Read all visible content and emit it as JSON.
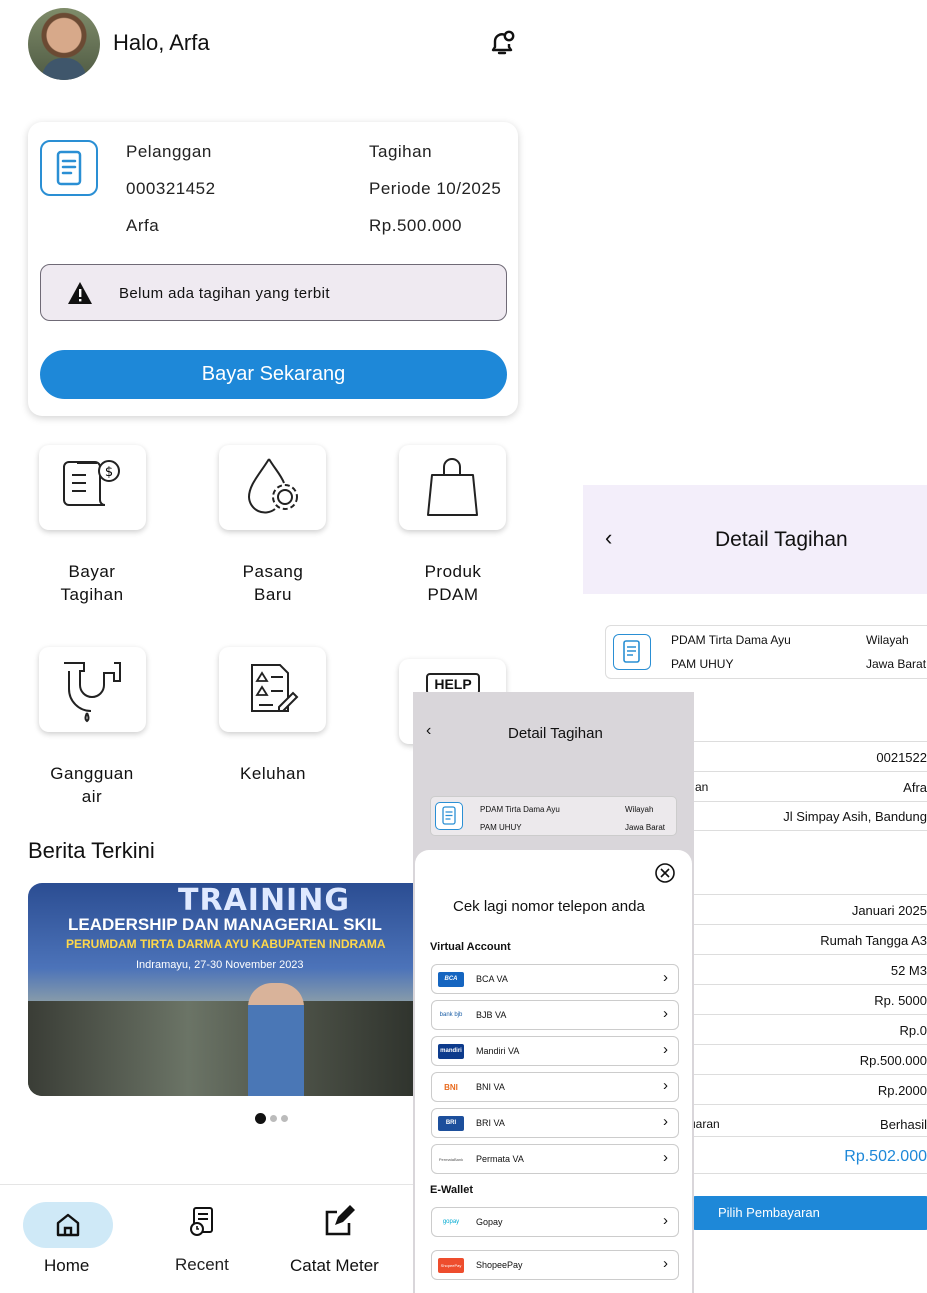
{
  "home": {
    "greeting": "Halo, Arfa",
    "card": {
      "customer_label": "Pelanggan",
      "customer_id": "000321452",
      "customer_name": "Arfa",
      "bill_label": "Tagihan",
      "period": "Periode 10/2025",
      "amount": "Rp.500.000",
      "notice": "Belum ada tagihan yang terbit",
      "pay_button": "Bayar Sekarang"
    },
    "menu": [
      {
        "l1": "Bayar",
        "l2": "Tagihan"
      },
      {
        "l1": "Pasang",
        "l2": "Baru"
      },
      {
        "l1": "Produk",
        "l2": "PDAM"
      },
      {
        "l1": "Gangguan",
        "l2": "air"
      },
      {
        "l1": "Keluhan",
        "l2": ""
      },
      {
        "help": "HELP"
      }
    ],
    "news_title": "Berita Terkini",
    "banner": {
      "line1": "TRAINING",
      "line2": "LEADERSHIP DAN MANAGERIAL SKIL",
      "line3": "PERUMDAM TIRTA DARMA AYU KABUPATEN INDRAMA",
      "line4": "Indramayu, 27-30 November 2023"
    },
    "nav": {
      "home": "Home",
      "recent": "Recent",
      "meter": "Catat Meter"
    }
  },
  "detail": {
    "title": "Detail Tagihan",
    "company": "PDAM Tirta Dama Ayu",
    "branch": "PAM UHUY",
    "region_label": "Wilayah",
    "region": "Jawa Barat",
    "rows_a": [
      {
        "label": "",
        "value": "0021522"
      },
      {
        "label": "an",
        "value": "Afra"
      },
      {
        "label": "",
        "value": "Jl Simpay Asih, Bandung"
      }
    ],
    "rows_b": [
      {
        "label": "",
        "value": "Januari 2025"
      },
      {
        "label": "",
        "value": "Rumah Tangga A3"
      },
      {
        "label": "",
        "value": "52 M3"
      },
      {
        "label": "",
        "value": "Rp. 5000"
      },
      {
        "label": "",
        "value": "Rp.0"
      },
      {
        "label": "",
        "value": "Rp.500.000"
      },
      {
        "label": "",
        "value": "Rp.2000"
      },
      {
        "label": "uaran",
        "value": "Berhasil"
      }
    ],
    "total": "Rp.502.000",
    "choose_button": "Pilih Pembayaran"
  },
  "sheet": {
    "title": "Detail Tagihan",
    "company": "PDAM Tirta Dama Ayu",
    "branch": "PAM UHUY",
    "region_label": "Wilayah",
    "region": "Jawa Barat",
    "prompt": "Cek lagi nomor telepon anda",
    "va_title": "Virtual Account",
    "va": [
      {
        "name": "BCA VA",
        "logo": "BCA",
        "color": "#1565c0"
      },
      {
        "name": "BJB VA",
        "logo": "bank bjb",
        "color": "#ffffff"
      },
      {
        "name": "Mandiri VA",
        "logo": "mandiri",
        "color": "#0d3b8c"
      },
      {
        "name": "BNI VA",
        "logo": "BNI",
        "color": "#ffffff"
      },
      {
        "name": "BRI VA",
        "logo": "BRI",
        "color": "#1d4f9c"
      },
      {
        "name": "Permata VA",
        "logo": "PermataBank",
        "color": "#ffffff"
      }
    ],
    "ew_title": "E-Wallet",
    "ew": [
      {
        "name": "Gopay",
        "logo": "gopay",
        "color": "#ffffff"
      },
      {
        "name": "ShopeePay",
        "logo": "ShopeePay",
        "color": "#ee4d2d"
      }
    ]
  }
}
